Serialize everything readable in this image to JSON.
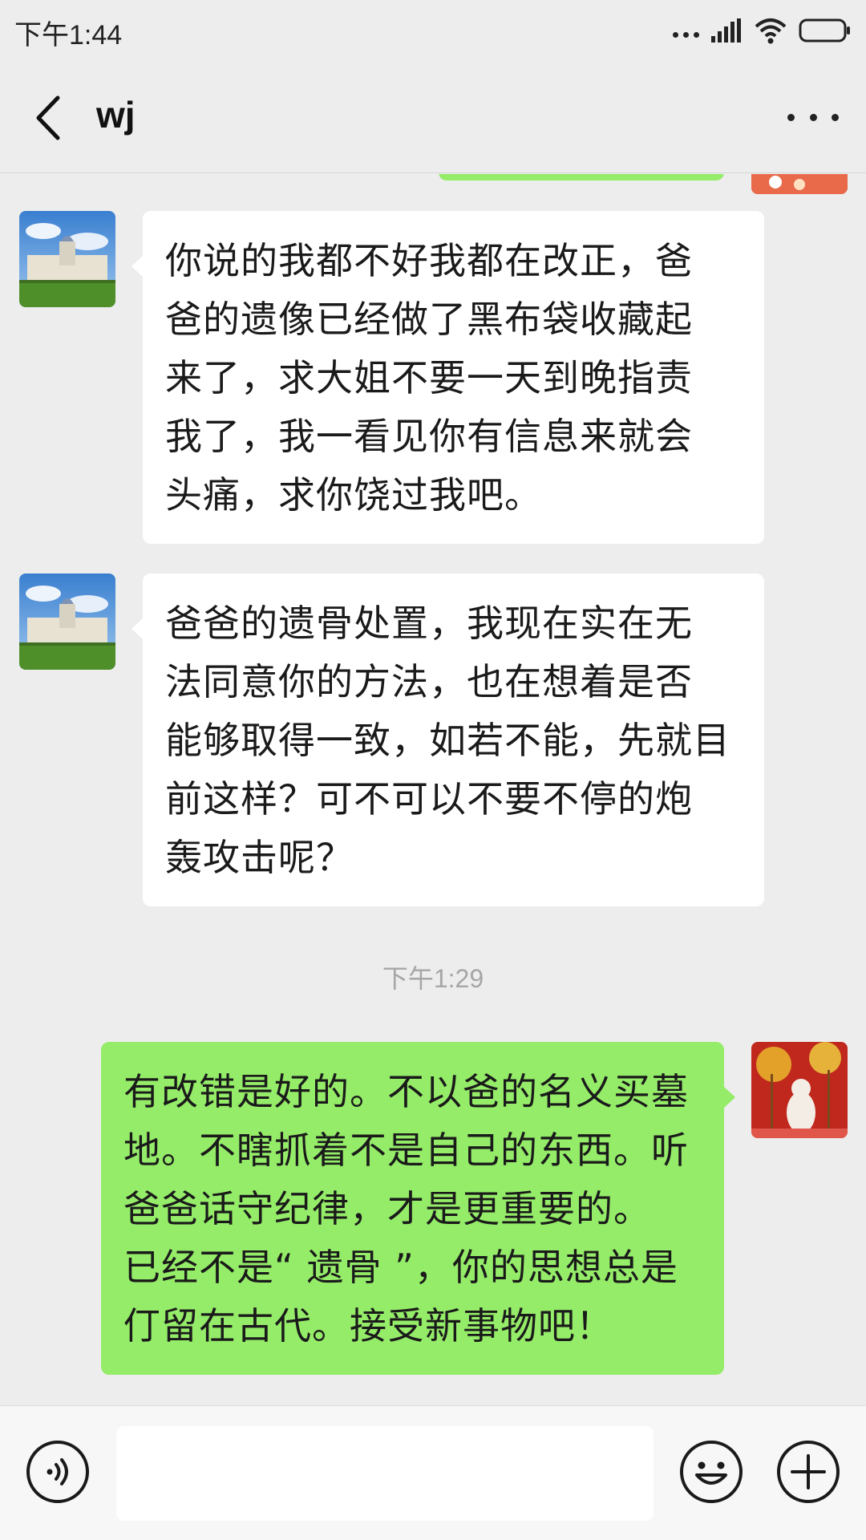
{
  "status_bar": {
    "time": "下午1:44",
    "icons": [
      "more-dots-icon",
      "signal-icon",
      "wifi-icon",
      "battery-icon"
    ]
  },
  "header": {
    "title": "wj",
    "back_icon": "chevron-left-icon",
    "more_icon": "more-horizontal-icon"
  },
  "colors": {
    "background": "#ededed",
    "incoming_bubble": "#ffffff",
    "outgoing_bubble": "#95ec69",
    "timestamp": "#a6a6a6"
  },
  "messages": [
    {
      "sender": "wj",
      "direction": "incoming",
      "lines": [
        "你说的我都不好我都在改正，爸",
        "爸的遗像已经做了黑布袋收藏起",
        "来了，求大姐不要一天到晚指责",
        "我了，我一看见你有信息来就会",
        "头痛，求你饶过我吧。"
      ]
    },
    {
      "sender": "wj",
      "direction": "incoming",
      "lines": [
        "爸爸的遗骨处置，我现在实在无",
        "法同意你的方法，也在想着是否",
        "能够取得一致，如若不能，先就目",
        "前这样？可不可以不要不停的炮",
        "轰攻击呢？"
      ]
    },
    {
      "sender": "me",
      "direction": "outgoing",
      "lines": [
        "有改错是好的。不以爸的名义买墓",
        "地。不瞎抓着不是自己的东西。听",
        "爸爸话守纪律，才是更重要的。",
        "已经不是“ 遗骨 ”，你的思想总是",
        "仃留在古代。接受新事物吧！"
      ]
    }
  ],
  "timestamp": "下午1:29",
  "input_bar": {
    "voice_icon": "voice-icon",
    "input_value": "",
    "emoji_icon": "emoji-icon",
    "plus_icon": "plus-icon"
  }
}
